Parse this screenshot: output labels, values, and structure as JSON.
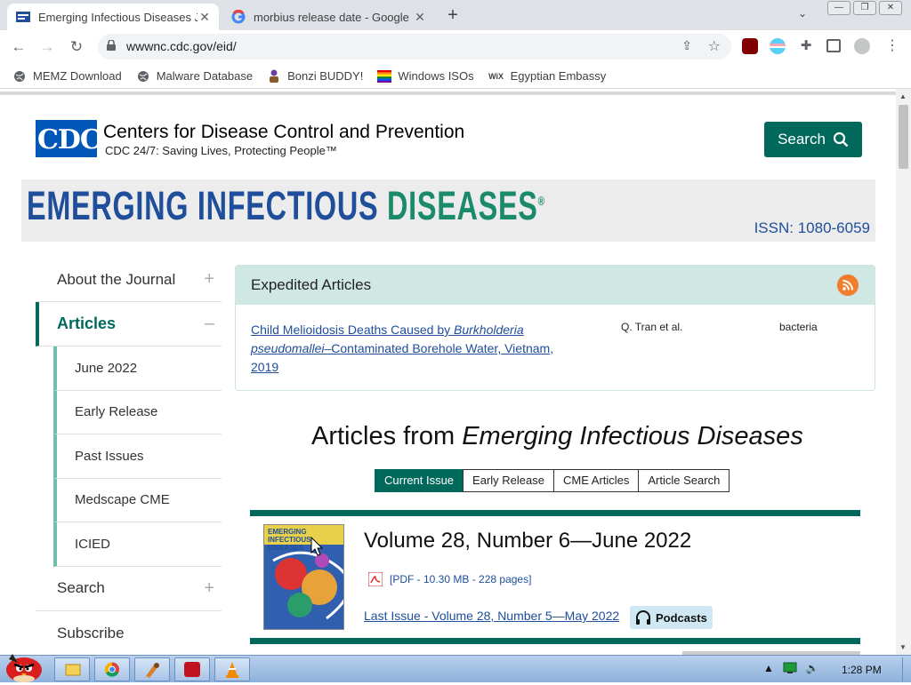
{
  "browser": {
    "tabs": [
      {
        "title": "Emerging Infectious Diseases Jo",
        "active": true
      },
      {
        "title": "morbius release date - Google S",
        "active": false
      }
    ],
    "url": "wwwnc.cdc.gov/eid/",
    "bookmarks": [
      {
        "label": "MEMZ Download",
        "icon": "globe-icon"
      },
      {
        "label": "Malware Database",
        "icon": "globe-icon"
      },
      {
        "label": "Bonzi BUDDY!",
        "icon": "gorilla-icon"
      },
      {
        "label": "Windows ISOs",
        "icon": "rainbow-flag-icon"
      },
      {
        "label": "Egyptian Embassy",
        "icon": "wix-icon"
      }
    ]
  },
  "header": {
    "logo_text": "CDC",
    "org_name": "Centers for Disease Control and Prevention",
    "tagline": "CDC 24/7: Saving Lives, Protecting People™",
    "search_label": "Search"
  },
  "banner": {
    "title_part1": "EMERGING INFECTIOUS ",
    "title_part2": "DISEASES",
    "reg": "®",
    "issn": "ISSN: 1080-6059"
  },
  "sidebar": {
    "items": [
      {
        "label": "About the Journal",
        "toggle": "+"
      },
      {
        "label": "Articles",
        "toggle": "–"
      },
      {
        "label": "June 2022"
      },
      {
        "label": "Early Release"
      },
      {
        "label": "Past Issues"
      },
      {
        "label": "Medscape CME"
      },
      {
        "label": "ICIED"
      },
      {
        "label": "Search",
        "toggle": "+"
      },
      {
        "label": "Subscribe"
      }
    ]
  },
  "expedited": {
    "heading": "Expedited Articles",
    "article_title_pre": "Child Melioidosis Deaths Caused by ",
    "article_title_italic": "Burkholderia pseudomallei",
    "article_title_post": "–Contaminated Borehole Water, Vietnam, 2019",
    "authors": "Q. Tran et al.",
    "category": "bacteria"
  },
  "articles": {
    "heading_pre": "Articles from ",
    "heading_italic": "Emerging Infectious Diseases",
    "tabs": [
      "Current Issue",
      "Early Release",
      "CME Articles",
      "Article Search"
    ],
    "active_tab": 0,
    "cover_title": "EMERGING INFECTIOUS DISEASES",
    "volume": "Volume 28, Number 6—June 2022",
    "pdf": "[PDF - 10.30 MB - 228 pages]",
    "last_issue": "Last Issue - Volume 28, Number 5—May 2022",
    "podcasts": "Podcasts"
  },
  "taskbar": {
    "clock": "1:28 PM"
  },
  "colors": {
    "cdc_blue": "#0057b8",
    "cdc_green": "#00695c",
    "link_blue": "#1f4e9a"
  }
}
